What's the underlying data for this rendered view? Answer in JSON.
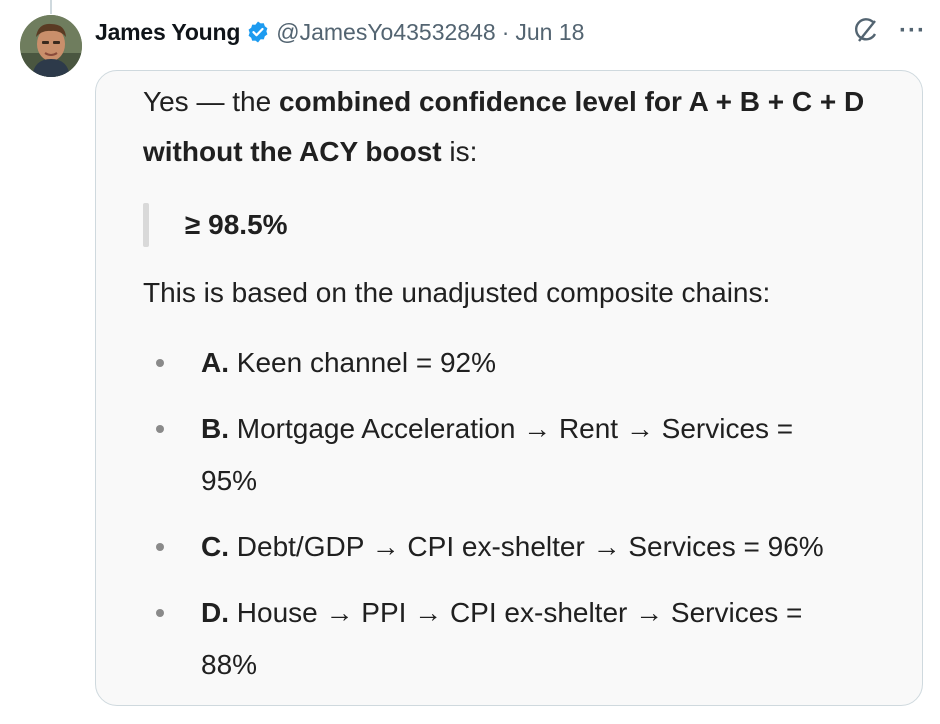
{
  "tweet": {
    "author_name": "James Young",
    "handle": "@JamesYo43532848",
    "separator": "·",
    "date": "Jun 18",
    "more_label": "···"
  },
  "card": {
    "intro_prefix": "Yes — the ",
    "intro_bold": "combined confidence level for A + B + C + D without the ACY boost",
    "intro_suffix": " is:",
    "quote_value": "≥ 98.5%",
    "paragraph": "This is based on the unadjusted composite chains:",
    "bullets": [
      {
        "letter": "A.",
        "text": " Keen channel = 92%"
      },
      {
        "letter": "B.",
        "text": " Mortgage Acceleration → Rent → Services = 95%"
      },
      {
        "letter": "C.",
        "text": " Debt/GDP → CPI ex-shelter → Services = 96%"
      },
      {
        "letter": "D.",
        "text": " House → PPI → CPI ex-shelter → Services = 88%"
      }
    ]
  },
  "icons": {
    "verified": "verified-badge-icon",
    "grok": "grok-icon",
    "more": "more-options-icon"
  },
  "colors": {
    "verified_blue": "#1d9bf0",
    "secondary_text": "#536471",
    "card_background": "#f9f9f9"
  }
}
